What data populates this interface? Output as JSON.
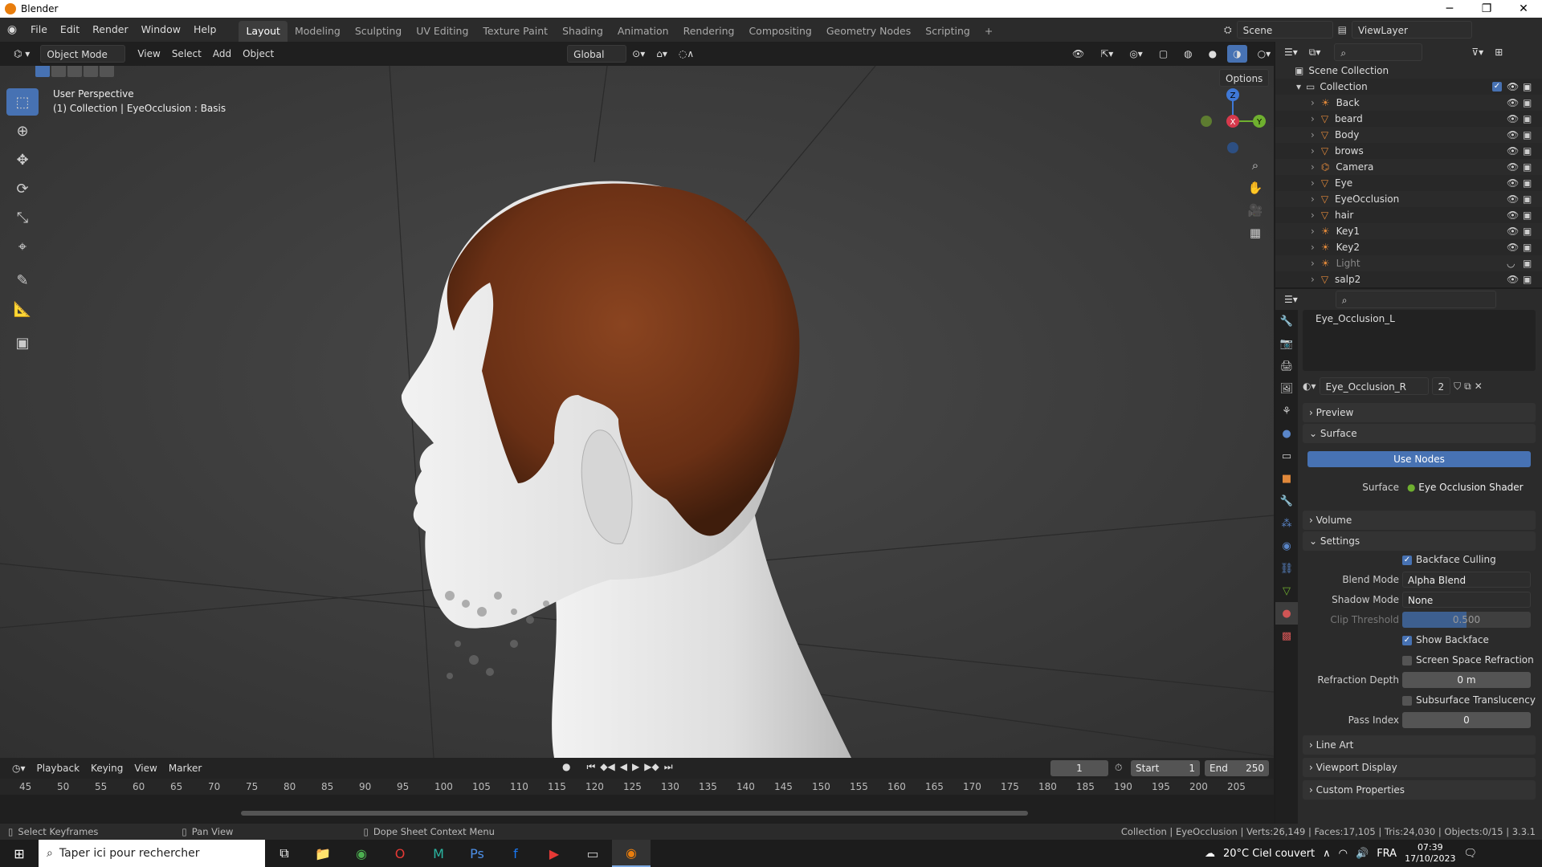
{
  "window": {
    "title": "Blender",
    "minimize": "─",
    "maximize": "❐",
    "close": "✕"
  },
  "menu": [
    "File",
    "Edit",
    "Render",
    "Window",
    "Help"
  ],
  "workspaces": [
    "Layout",
    "Modeling",
    "Sculpting",
    "UV Editing",
    "Texture Paint",
    "Shading",
    "Animation",
    "Rendering",
    "Compositing",
    "Geometry Nodes",
    "Scripting",
    "+"
  ],
  "active_workspace": "Layout",
  "scene": {
    "label": "Scene",
    "view_layer": "ViewLayer"
  },
  "viewport_header": {
    "mode": "Object Mode",
    "view": "View",
    "select": "Select",
    "add": "Add",
    "object": "Object",
    "orientation": "Global",
    "options": "Options"
  },
  "viewport": {
    "perspective": "User Perspective",
    "context": "(1) Collection | EyeOcclusion : Basis"
  },
  "gizmo": {
    "x": "X",
    "y": "Y",
    "z": "Z"
  },
  "outliner": {
    "scene_collection": "Scene Collection",
    "collection": "Collection",
    "items": [
      {
        "name": "Back",
        "icon": "light-icon"
      },
      {
        "name": "beard",
        "icon": "mesh-icon"
      },
      {
        "name": "Body",
        "icon": "mesh-icon"
      },
      {
        "name": "brows",
        "icon": "mesh-icon"
      },
      {
        "name": "Camera",
        "icon": "camera-icon"
      },
      {
        "name": "Eye",
        "icon": "mesh-icon"
      },
      {
        "name": "EyeOcclusion",
        "icon": "mesh-icon"
      },
      {
        "name": "hair",
        "icon": "mesh-icon"
      },
      {
        "name": "Key1",
        "icon": "light-icon"
      },
      {
        "name": "Key2",
        "icon": "light-icon"
      },
      {
        "name": "Light",
        "icon": "light-icon"
      },
      {
        "name": "salp2",
        "icon": "mesh-icon"
      }
    ]
  },
  "properties": {
    "slot_item": "Eye_Occlusion_L",
    "material_name": "Eye_Occlusion_R",
    "material_users": "2",
    "panels": {
      "preview": "Preview",
      "surface": "Surface",
      "volume": "Volume",
      "settings": "Settings",
      "line_art": "Line Art",
      "viewport_display": "Viewport Display",
      "custom_properties": "Custom Properties"
    },
    "use_nodes": "Use Nodes",
    "surface_label": "Surface",
    "surface_value": "Eye Occlusion Shader",
    "settings": {
      "backface_culling": "Backface Culling",
      "blend_mode_label": "Blend Mode",
      "blend_mode": "Alpha Blend",
      "shadow_mode_label": "Shadow Mode",
      "shadow_mode": "None",
      "clip_threshold_label": "Clip Threshold",
      "clip_threshold": "0.500",
      "show_backface": "Show Backface",
      "screen_space_refraction": "Screen Space Refraction",
      "refraction_depth_label": "Refraction Depth",
      "refraction_depth": "0 m",
      "subsurface_translucency": "Subsurface Translucency",
      "pass_index_label": "Pass Index",
      "pass_index": "0"
    }
  },
  "timeline": {
    "playback": "Playback",
    "keying": "Keying",
    "view": "View",
    "marker": "Marker",
    "current_frame": "1",
    "start_label": "Start",
    "start": "1",
    "end_label": "End",
    "end": "250",
    "ticks": [
      "45",
      "50",
      "55",
      "60",
      "65",
      "70",
      "75",
      "80",
      "85",
      "90",
      "95",
      "100",
      "105",
      "110",
      "115",
      "120",
      "125",
      "130",
      "135",
      "140",
      "145",
      "150",
      "155",
      "160",
      "165",
      "170",
      "175",
      "180",
      "185",
      "190",
      "195",
      "200",
      "205"
    ]
  },
  "status": {
    "left": "Select Keyframes",
    "middle": "Pan View",
    "context": "Dope Sheet Context Menu",
    "right": "Collection | EyeOcclusion | Verts:26,149 | Faces:17,105 | Tris:24,030 | Objects:0/15 | 3.3.1"
  },
  "taskbar": {
    "search": "Taper ici pour rechercher",
    "weather": "20°C  Ciel couvert",
    "lang": "FRA",
    "time": "07:39",
    "date": "17/10/2023"
  }
}
